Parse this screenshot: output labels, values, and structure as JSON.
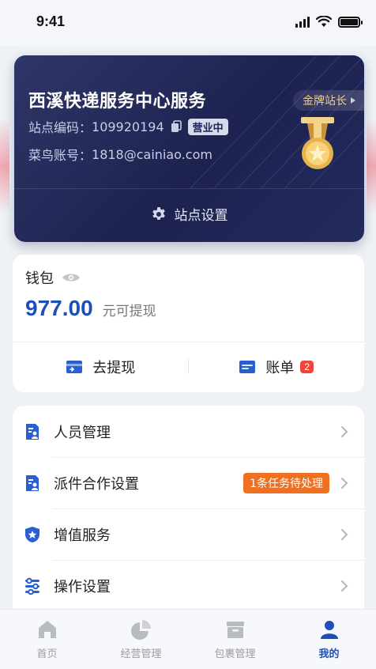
{
  "status_bar": {
    "time": "9:41"
  },
  "station": {
    "name": "西溪快递服务中心服务",
    "code_label": "站点编码：",
    "code": "109920194",
    "status": "营业中",
    "account_label": "菜鸟账号：",
    "account": "1818@cainiao.com",
    "rank": "金牌站长",
    "settings_label": "站点设置"
  },
  "wallet": {
    "title": "钱包",
    "balance": "977.00",
    "balance_suffix": "元可提现",
    "withdraw_label": "去提现",
    "bill_label": "账单",
    "bill_count": "2"
  },
  "menu": {
    "items": [
      {
        "label": "人员管理"
      },
      {
        "label": "派件合作设置",
        "badge": "1条任务待处理"
      },
      {
        "label": "增值服务"
      },
      {
        "label": "操作设置"
      }
    ]
  },
  "tabbar": {
    "tabs": [
      {
        "label": "首页",
        "icon": "home-icon"
      },
      {
        "label": "经营管理",
        "icon": "pie-chart-icon"
      },
      {
        "label": "包裹管理",
        "icon": "package-box-icon"
      },
      {
        "label": "我的",
        "icon": "person-icon"
      }
    ],
    "active_index": 3
  },
  "colors": {
    "accent": "#1e4fb8",
    "card_dark": "#1d2250",
    "gold": "#f4cc82",
    "badge_red": "#f0453a",
    "badge_orange": "#f07022"
  }
}
